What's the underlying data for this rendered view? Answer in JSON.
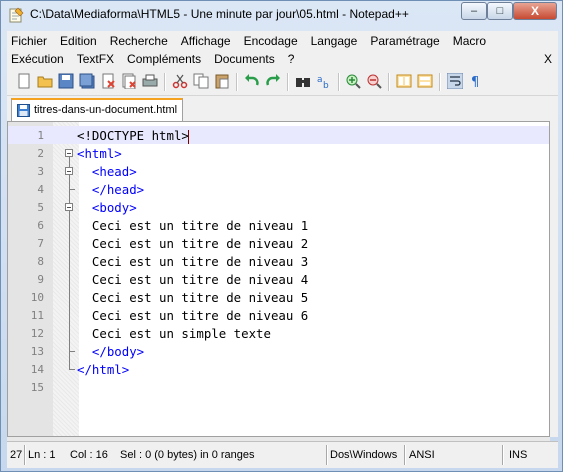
{
  "window": {
    "title": "C:\\Data\\Mediaforma\\HTML5 - Une minute par jour\\05.html - Notepad++",
    "minimize_label": "–",
    "maximize_label": "□",
    "close_label": "X"
  },
  "menu": {
    "row1": [
      "Fichier",
      "Edition",
      "Recherche",
      "Affichage",
      "Encodage",
      "Langage",
      "Paramétrage",
      "Macro"
    ],
    "row2": [
      "Exécution",
      "TextFX",
      "Compléments",
      "Documents",
      "?"
    ],
    "close_doc": "X"
  },
  "toolbar": {
    "icons": [
      "new-file-icon",
      "open-file-icon",
      "save-icon",
      "save-all-icon",
      "close-icon",
      "close-all-icon",
      "print-icon",
      "cut-icon",
      "copy-icon",
      "paste-icon",
      "undo-icon",
      "redo-icon",
      "find-icon",
      "replace-icon",
      "zoom-in-icon",
      "zoom-out-icon",
      "sync-vertical-icon",
      "sync-horizontal-icon",
      "word-wrap-icon",
      "show-all-chars-icon"
    ]
  },
  "tab": {
    "label": "titres-dans-un-document.html"
  },
  "editor": {
    "lines": [
      {
        "num": "1",
        "code": "<!DOCTYPE html>"
      },
      {
        "num": "2",
        "code": "<html>"
      },
      {
        "num": "3",
        "code": "  <head>"
      },
      {
        "num": "4",
        "code": "  </head>"
      },
      {
        "num": "5",
        "code": "  <body>"
      },
      {
        "num": "6",
        "code": "  Ceci est un titre de niveau 1"
      },
      {
        "num": "7",
        "code": "  Ceci est un titre de niveau 2"
      },
      {
        "num": "8",
        "code": "  Ceci est un titre de niveau 3"
      },
      {
        "num": "9",
        "code": "  Ceci est un titre de niveau 4"
      },
      {
        "num": "10",
        "code": "  Ceci est un titre de niveau 5"
      },
      {
        "num": "11",
        "code": "  Ceci est un titre de niveau 6"
      },
      {
        "num": "12",
        "code": "  Ceci est un simple texte"
      },
      {
        "num": "13",
        "code": "  </body>"
      },
      {
        "num": "14",
        "code": "</html>"
      },
      {
        "num": "15",
        "code": ""
      }
    ]
  },
  "status": {
    "length": "27",
    "ln": "Ln : 1",
    "col": "Col : 16",
    "sel": "Sel : 0 (0 bytes) in 0 ranges",
    "eol": "Dos\\Windows",
    "encoding": "ANSI",
    "mode": "INS"
  }
}
